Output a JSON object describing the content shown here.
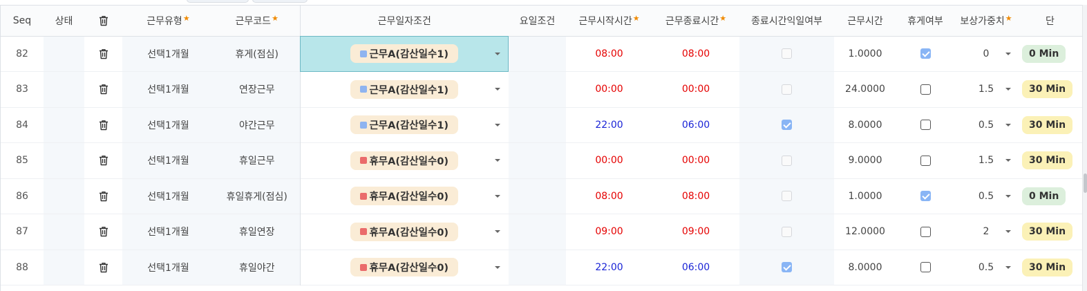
{
  "header": {
    "seq": "Seq",
    "status": "상태",
    "work_type": "근무유형",
    "work_code": "근무코드",
    "date_cond": "근무일자조건",
    "day_cond": "요일조건",
    "start_time": "근무시작시간",
    "end_time": "근무종료시간",
    "end_next_day": "종료시간익일여부",
    "work_hours": "근무시간",
    "break": "휴게여부",
    "weight": "보상가중치",
    "unit_partial": "단",
    "required_mark": "★"
  },
  "colors": {
    "work_square": "#8fb4f0",
    "rest_square": "#ea6b6b",
    "chip_bg": "#faecd6",
    "time_day": "#e50000",
    "time_night": "#1a24d6"
  },
  "rows": [
    {
      "seq": "82",
      "status": "",
      "type": "선택1개월",
      "code": "휴게(점심)",
      "cond": "근무A(감산일수1)",
      "cond_kind": "work",
      "day": "",
      "start": "08:00",
      "end": "08:00",
      "time_color": "red",
      "next_day": false,
      "hours": "1.0000",
      "break": true,
      "weight": "0",
      "unit": "0 Min",
      "unit_color": "green",
      "selected": true
    },
    {
      "seq": "83",
      "status": "",
      "type": "선택1개월",
      "code": "연장근무",
      "cond": "근무A(감산일수1)",
      "cond_kind": "work",
      "day": "",
      "start": "00:00",
      "end": "00:00",
      "time_color": "red",
      "next_day": false,
      "hours": "24.0000",
      "break": false,
      "weight": "1.5",
      "unit": "30 Min",
      "unit_color": "yellow",
      "selected": false
    },
    {
      "seq": "84",
      "status": "",
      "type": "선택1개월",
      "code": "야간근무",
      "cond": "근무A(감산일수1)",
      "cond_kind": "work",
      "day": "",
      "start": "22:00",
      "end": "06:00",
      "time_color": "blue",
      "next_day": true,
      "hours": "8.0000",
      "break": false,
      "weight": "0.5",
      "unit": "30 Min",
      "unit_color": "yellow",
      "selected": false
    },
    {
      "seq": "85",
      "status": "",
      "type": "선택1개월",
      "code": "휴일근무",
      "cond": "휴무A(감산일수0)",
      "cond_kind": "rest",
      "day": "",
      "start": "00:00",
      "end": "00:00",
      "time_color": "red",
      "next_day": false,
      "hours": "9.0000",
      "break": false,
      "weight": "1.5",
      "unit": "30 Min",
      "unit_color": "yellow",
      "selected": false
    },
    {
      "seq": "86",
      "status": "",
      "type": "선택1개월",
      "code": "휴일휴게(점심)",
      "cond": "휴무A(감산일수0)",
      "cond_kind": "rest",
      "day": "",
      "start": "08:00",
      "end": "08:00",
      "time_color": "red",
      "next_day": false,
      "hours": "1.0000",
      "break": true,
      "weight": "0.5",
      "unit": "0 Min",
      "unit_color": "green",
      "selected": false
    },
    {
      "seq": "87",
      "status": "",
      "type": "선택1개월",
      "code": "휴일연장",
      "cond": "휴무A(감산일수0)",
      "cond_kind": "rest",
      "day": "",
      "start": "09:00",
      "end": "09:00",
      "time_color": "red",
      "next_day": false,
      "hours": "12.0000",
      "break": false,
      "weight": "2",
      "unit": "30 Min",
      "unit_color": "yellow",
      "selected": false
    },
    {
      "seq": "88",
      "status": "",
      "type": "선택1개월",
      "code": "휴일야간",
      "cond": "휴무A(감산일수0)",
      "cond_kind": "rest",
      "day": "",
      "start": "22:00",
      "end": "06:00",
      "time_color": "blue",
      "next_day": true,
      "hours": "8.0000",
      "break": false,
      "weight": "0.5",
      "unit": "30 Min",
      "unit_color": "yellow",
      "selected": false
    }
  ]
}
